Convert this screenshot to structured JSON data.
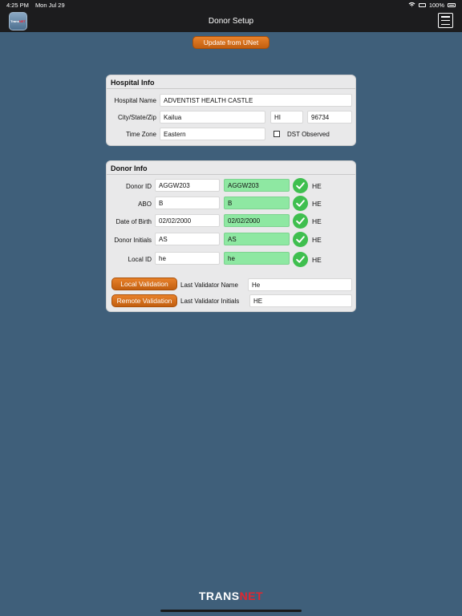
{
  "status": {
    "time": "4:25 PM",
    "date": "Mon Jul 29",
    "battery": "100%"
  },
  "nav": {
    "title": "Donor Setup",
    "icon_text_a": "Trans",
    "icon_text_b": "NET"
  },
  "update_button": "Update from UNet",
  "hospital": {
    "header": "Hospital Info",
    "name_label": "Hospital Name",
    "name": "ADVENTIST HEALTH CASTLE",
    "city_label": "City/State/Zip",
    "city": "Kailua",
    "state": "HI",
    "zip": "96734",
    "tz_label": "Time Zone",
    "tz": "Eastern",
    "dst_label": "DST Observed"
  },
  "donor": {
    "header": "Donor Info",
    "rows": [
      {
        "label": "Donor ID",
        "value": "AGGW203",
        "verify": "AGGW203",
        "initials": "HE"
      },
      {
        "label": "ABO",
        "value": "B",
        "verify": "B",
        "initials": "HE"
      },
      {
        "label": "Date of Birth",
        "value": "02/02/2000",
        "verify": "02/02/2000",
        "initials": "HE"
      },
      {
        "label": "Donor Initials",
        "value": "AS",
        "verify": "AS",
        "initials": "HE"
      },
      {
        "label": "Local ID",
        "value": "he",
        "verify": "he",
        "initials": "HE"
      }
    ],
    "local_validation": "Local Validation",
    "remote_validation": "Remote Validation",
    "validator_name_label": "Last Validator Name",
    "validator_name": "He",
    "validator_initials_label": "Last Validator Initials",
    "validator_initials": "HE"
  },
  "footer": {
    "logo_a": "TRANS",
    "logo_b": "NET"
  }
}
